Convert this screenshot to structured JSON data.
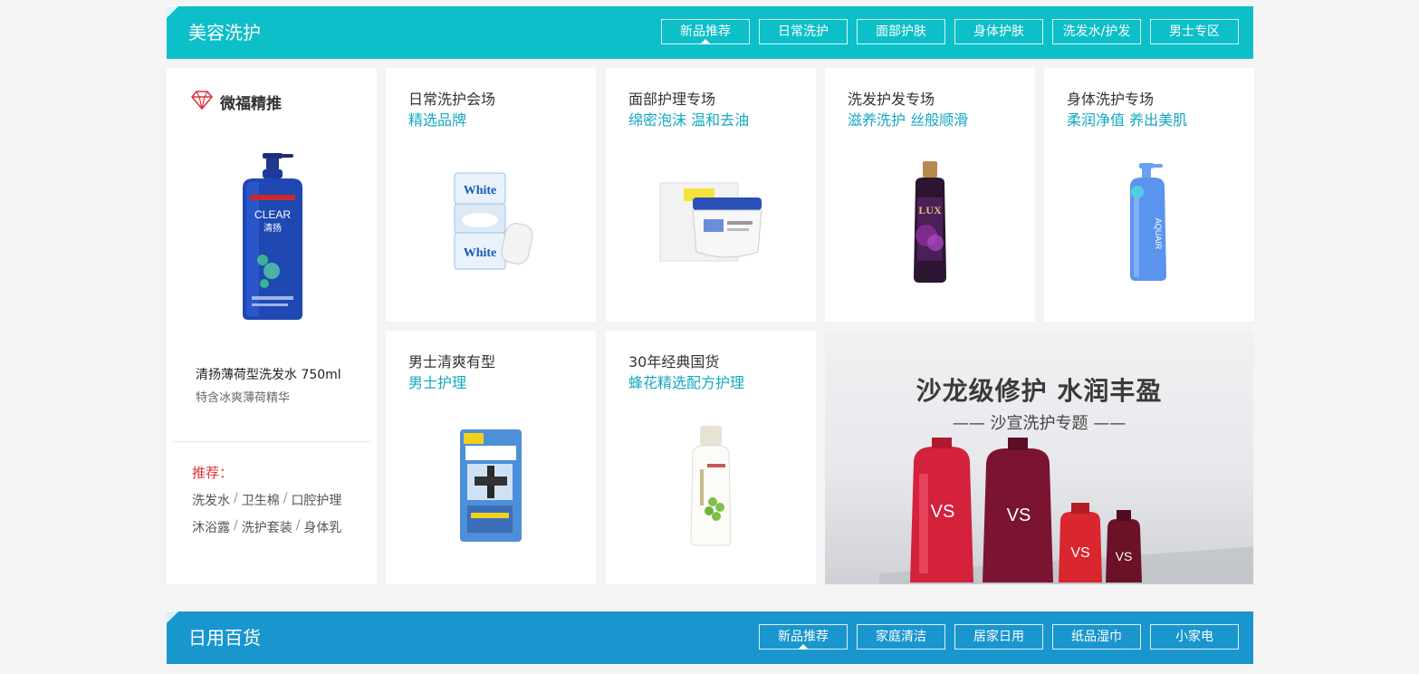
{
  "section1": {
    "title": "美容洗护",
    "tabs": [
      "新品推荐",
      "日常洗护",
      "面部护肤",
      "身体护肤",
      "洗发水/护发",
      "男士专区"
    ]
  },
  "featured": {
    "heading": "微福精推",
    "product_name": "清扬薄荷型洗发水 750ml",
    "product_desc": "特含冰爽薄荷精华",
    "recommend_label": "推荐：",
    "row1": [
      "洗发水",
      "卫生棉",
      "口腔护理"
    ],
    "row2": [
      "沐浴露",
      "洗护套装",
      "身体乳"
    ],
    "separator": "/",
    "brand_text": "CLEAR",
    "brand_cn": "清扬"
  },
  "cards": [
    {
      "title": "日常洗护会场",
      "subtitle": "精选品牌",
      "brand": "White"
    },
    {
      "title": "面部护理专场",
      "subtitle": "绵密泡沫 温和去油",
      "brand": ""
    },
    {
      "title": "洗发护发专场",
      "subtitle": "滋养洗护 丝般顺滑",
      "brand": "LUX"
    },
    {
      "title": "身体洗护专场",
      "subtitle": "柔润净值 养出美肌",
      "brand": "AQUAIR"
    },
    {
      "title": "男士清爽有型",
      "subtitle": "男士护理",
      "brand": ""
    },
    {
      "title": "30年经典国货",
      "subtitle": "蜂花精选配方护理",
      "brand": ""
    }
  ],
  "banner": {
    "title": "沙龙级修护 水润丰盈",
    "subtitle": "—— 沙宣洗护专题 ——",
    "brand": "VS"
  },
  "section2": {
    "title": "日用百货",
    "tabs": [
      "新品推荐",
      "家庭清洁",
      "居家日用",
      "纸品湿巾",
      "小家电"
    ]
  },
  "colors": {
    "section1_bg": "#0dbfc8",
    "section2_bg": "#1a96cf",
    "subtitle_teal": "#13a8c2",
    "recommend_red": "#e0303a"
  }
}
